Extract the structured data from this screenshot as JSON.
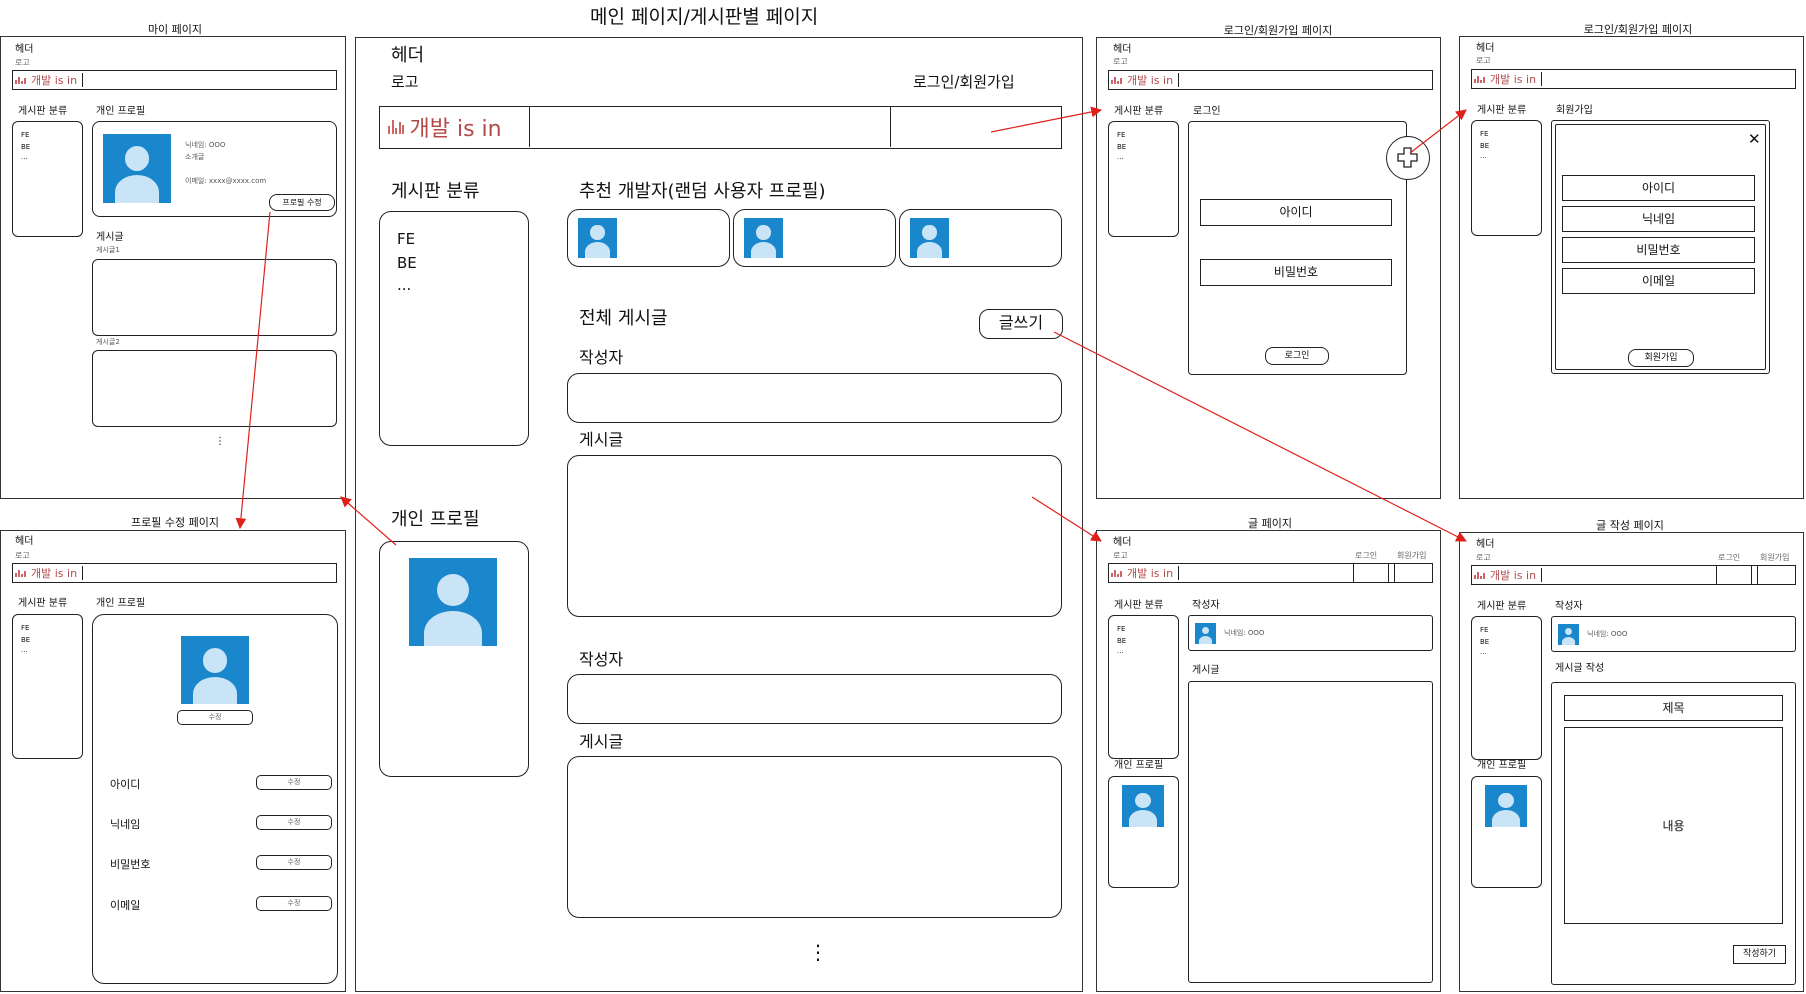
{
  "main_title": "메인 페이지/게시판별 페이지",
  "frames": {
    "mypage": "마이 페이지",
    "profile_edit": "프로필 수정 페이지",
    "login": "로그인/회원가입 페이지",
    "signup": "로그인/회원가입 페이지",
    "post": "글 페이지",
    "write": "글 작성 페이지"
  },
  "common": {
    "header": "헤더",
    "logo": "로고",
    "logo_text": "개발 is in",
    "board_category": "게시판 분류",
    "board_items": [
      "FE",
      "BE",
      "..."
    ],
    "personal_profile": "개인 프로필",
    "login_signup": "로그인/회원가입",
    "login": "로그인",
    "signup": "회원가입"
  },
  "main": {
    "recommended": "추천 개발자(랜덤 사용자 프로필)",
    "all_posts": "전체 게시글",
    "write_button": "글쓰기",
    "author": "작성자",
    "post": "게시글",
    "more": "⋮"
  },
  "mypage": {
    "nickname": "닉네임: OOO",
    "intro": "소개글",
    "email": "이메일: xxxx@xxxx.com",
    "edit_profile_button": "프로필 수정",
    "posts": "게시글",
    "post1": "게시글1",
    "post2": "게시글2",
    "more": "⋮"
  },
  "profile_edit": {
    "edit": "수정",
    "fields": [
      "아이디",
      "닉네임",
      "비밀번호",
      "이메일"
    ]
  },
  "login_page": {
    "id": "아이디",
    "password": "비밀번호",
    "login_button": "로그인"
  },
  "signup_page": {
    "fields": [
      "아이디",
      "닉네임",
      "비밀번호",
      "이메일"
    ],
    "signup_button": "회원가입",
    "close": "✕"
  },
  "post_page": {
    "author": "작성자",
    "nickname": "닉네임: OOO",
    "post": "게시글"
  },
  "write_page": {
    "author": "작성자",
    "nickname": "닉네임: OOO",
    "compose": "게시글 작성",
    "title": "제목",
    "content": "내용",
    "submit": "작성하기"
  },
  "colors": {
    "accent": "#b34a4a",
    "avatar_bg": "#1a86cc",
    "arrow": "#e0201a"
  }
}
